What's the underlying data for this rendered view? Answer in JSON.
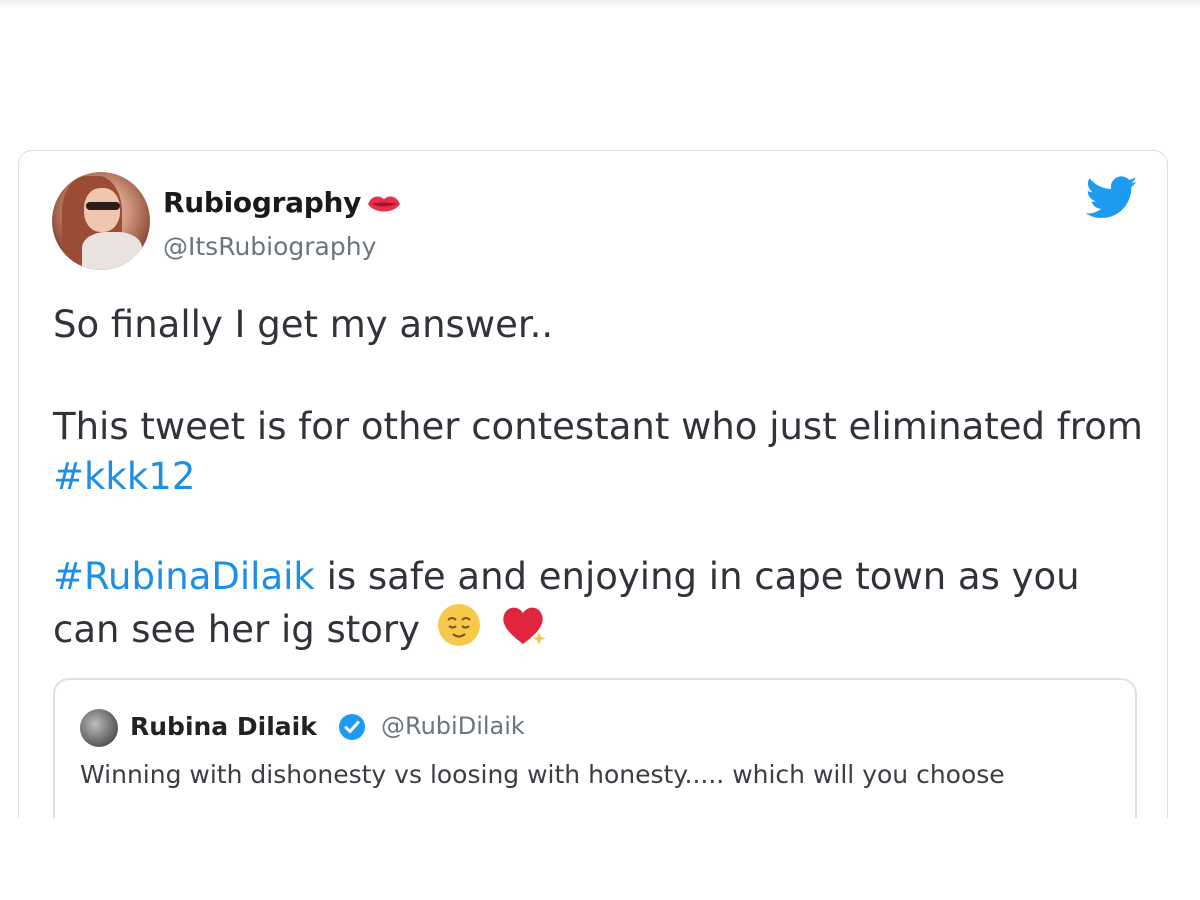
{
  "tweet": {
    "display_name": "Rubiography",
    "handle": "@ItsRubiography",
    "line1": "So finally I get my answer..",
    "line2_prefix": "This tweet is for other contestant who just eliminated from",
    "hashtag1": "#kkk12",
    "hashtag2": "#RubinaDilaik",
    "line3_suffix": " is safe and enjoying in cape town as you",
    "line4": "can see her ig story"
  },
  "quoted_tweet": {
    "display_name": "Rubina Dilaik",
    "handle": "@RubiDilaik",
    "text": "Winning with dishonesty vs loosing with honesty..... which will you choose"
  },
  "icons": {
    "brand": "twitter-bird-icon",
    "name_badge": "lips-icon",
    "verified": "verified-badge-icon",
    "emojis": [
      "relieved-face-emoji",
      "sparkling-heart-emoji"
    ]
  },
  "colors": {
    "hashtag": "#1d8fe6",
    "twitter_blue": "#1d9bf0",
    "text": "#30343a",
    "muted": "#6b7580"
  }
}
